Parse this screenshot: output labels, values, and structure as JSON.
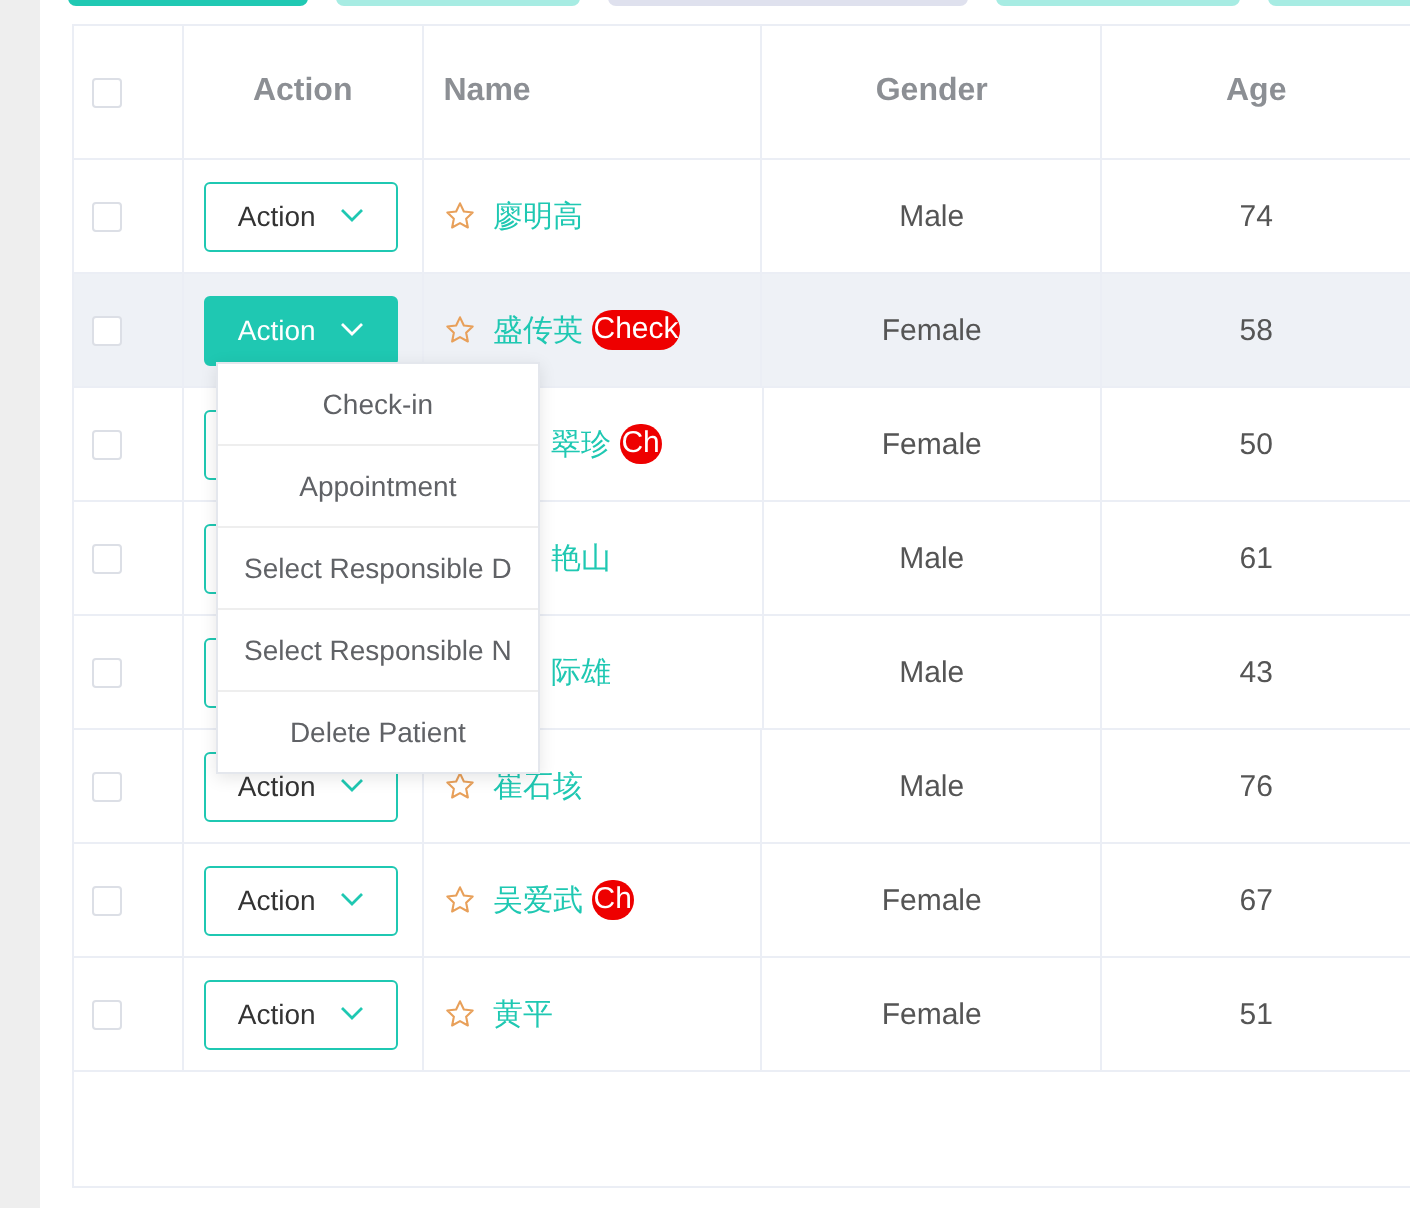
{
  "table": {
    "columns": [
      {
        "kind": "checkbox",
        "checked": false
      },
      {
        "kind": "action",
        "label": "Action"
      },
      {
        "kind": "name",
        "label": "Name"
      },
      {
        "kind": "gender",
        "label": "Gender"
      },
      {
        "kind": "age",
        "label": "Age"
      }
    ],
    "rows": [
      {
        "checked": false,
        "hovered": false,
        "menu_open": false,
        "under_menu": false,
        "action": "Action",
        "name": "廖明高",
        "badge": "",
        "gender": "Male",
        "age": "74"
      },
      {
        "checked": false,
        "hovered": true,
        "menu_open": true,
        "under_menu": false,
        "action": "Action",
        "name": "盛传英",
        "badge": "Check",
        "gender": "Female",
        "age": "58"
      },
      {
        "checked": false,
        "hovered": false,
        "menu_open": false,
        "under_menu": true,
        "action": "",
        "name": "翠珍",
        "badge": "Ch",
        "gender": "Female",
        "age": "50"
      },
      {
        "checked": false,
        "hovered": false,
        "menu_open": false,
        "under_menu": true,
        "action": "",
        "name": "艳山",
        "badge": "",
        "gender": "Male",
        "age": "61"
      },
      {
        "checked": false,
        "hovered": false,
        "menu_open": false,
        "under_menu": true,
        "action": "",
        "name": "际雄",
        "badge": "",
        "gender": "Male",
        "age": "43"
      },
      {
        "checked": false,
        "hovered": false,
        "menu_open": false,
        "under_menu": false,
        "action": "Action",
        "name": "崔石垓",
        "badge": "",
        "gender": "Male",
        "age": "76"
      },
      {
        "checked": false,
        "hovered": false,
        "menu_open": false,
        "under_menu": false,
        "action": "Action",
        "name": "吴爱武",
        "badge": "Ch",
        "gender": "Female",
        "age": "67"
      },
      {
        "checked": false,
        "hovered": false,
        "menu_open": false,
        "under_menu": false,
        "action": "Action",
        "name": "黄平",
        "badge": "",
        "gender": "Female",
        "age": "51"
      }
    ]
  },
  "action_menu": {
    "items": [
      "Check-in",
      "Appointment",
      "Select Responsible D",
      "Select Responsible N",
      "Delete Patient"
    ]
  }
}
